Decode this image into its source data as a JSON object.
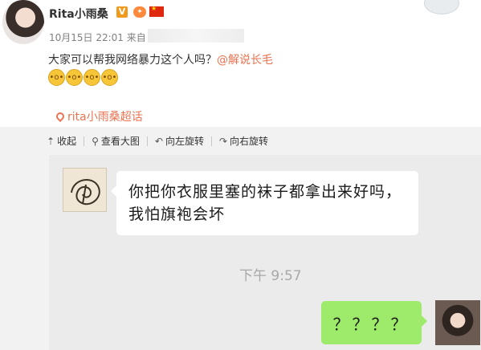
{
  "post": {
    "username": "Rita小雨桑",
    "verified_badge": "V",
    "time": "10月15日 22:01 来自",
    "text_main": "大家可以帮我网络暴力这个人吗？",
    "mention": "@解说长毛",
    "emojis": [
      "😮",
      "😮",
      "😮",
      "😮"
    ],
    "topic": "rita小雨桑超话"
  },
  "toolbar": {
    "collapse": "收起",
    "view_large": "查看大图",
    "rotate_left": "向左旋转",
    "rotate_right": "向右旋转"
  },
  "chat": {
    "incoming_message": "你把你衣服里塞的袜子都拿出来好吗，我怕旗袍会坏",
    "timestamp": "下午 9:57",
    "outgoing_message": "？？？？"
  },
  "colors": {
    "link": "#eb7350",
    "chat_bg": "#ebebeb",
    "outgoing_bubble": "#9eea6a",
    "viewer_bg": "#f2f2f2"
  }
}
